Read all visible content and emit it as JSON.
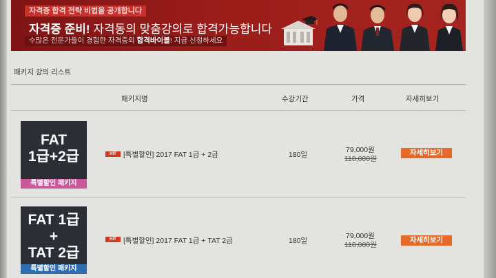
{
  "banner": {
    "tag": "자격증 합격 전략 비법을 공개합니다",
    "headline_bold": "자격증 준비!",
    "headline_rest": " 자격동의 맞춤강의로 합격가능합니다",
    "sub_pre": "수많은 전문가들이 경험한 자격증의 ",
    "sub_bold": "합격바이블",
    "sub_post": "! 지금 신청하세요"
  },
  "section_title": "패키지 강의 리스트",
  "table": {
    "headers": {
      "name": "패키지명",
      "period": "수강기간",
      "price": "가격",
      "detail": "자세히보기"
    },
    "rows": [
      {
        "thumb_lines": [
          "FAT",
          "1급+2급"
        ],
        "thumb_footer": "특별할인 패키지",
        "thumb_footer_color": "#c9579a",
        "badge": "HIT",
        "name": "[특별할인] 2017 FAT 1급 + 2급",
        "period": "180일",
        "price": "79,000원",
        "price_original": "118,000원",
        "detail_button": "자세히보기"
      },
      {
        "thumb_lines": [
          "FAT 1급",
          "+",
          "TAT 2급"
        ],
        "thumb_footer": "특별할인 패키지",
        "thumb_footer_color": "#2f6db0",
        "badge": "HIT",
        "name": "[특별할인] 2017 FAT 1급 + TAT 2급",
        "period": "180일",
        "price": "79,000원",
        "price_original": "118,000원",
        "detail_button": "자세히보기"
      }
    ]
  },
  "colors": {
    "banner_red": "#9a1d1a",
    "button_orange": "#e66a2a",
    "thumb_dark": "#2b2e34"
  }
}
